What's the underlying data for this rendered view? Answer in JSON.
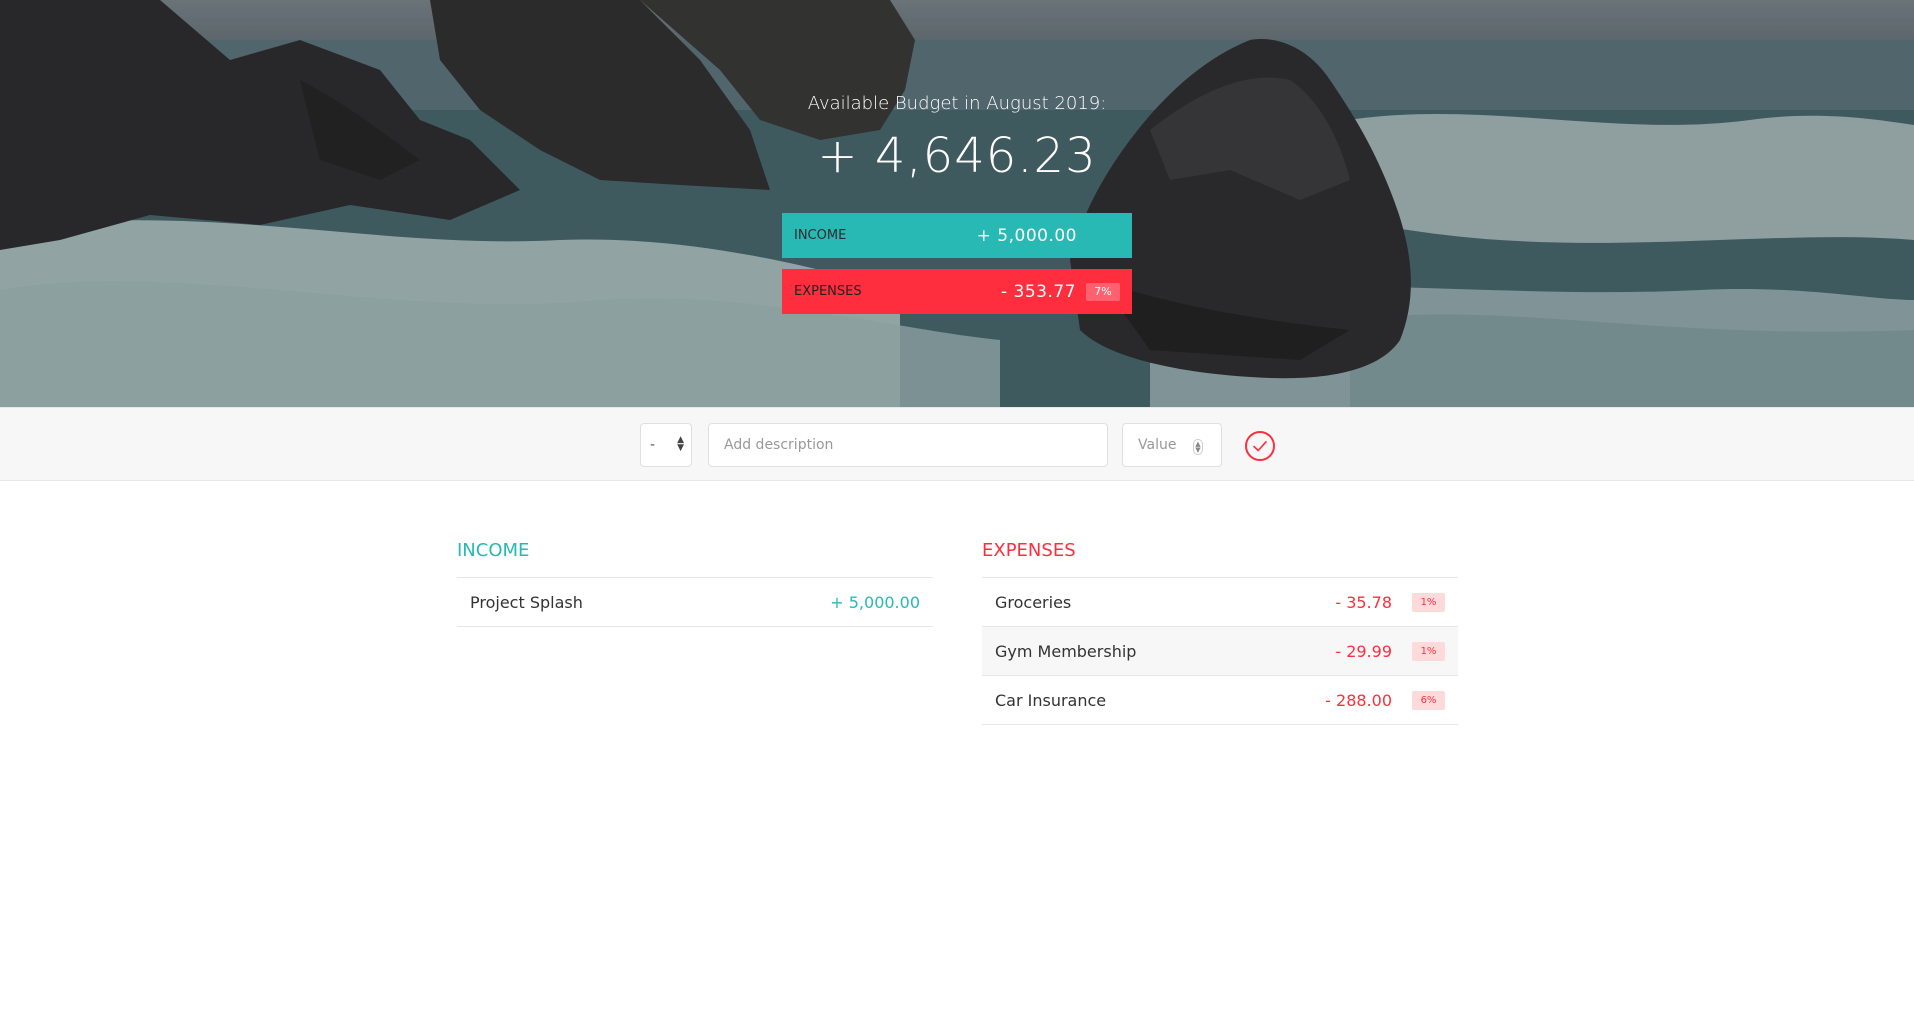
{
  "budget": {
    "title": "Available Budget in August 2019:",
    "value": "+ 4,646.23"
  },
  "summary": {
    "income_label": "Income",
    "income_value": "+ 5,000.00",
    "expenses_label": "Expenses",
    "expenses_value": "- 353.77",
    "expenses_percentage": "7%"
  },
  "add_form": {
    "type_value": "-",
    "description_placeholder": "Add description",
    "value_placeholder": "Value"
  },
  "income_list": {
    "title": "Income",
    "items": [
      {
        "description": "Project Splash",
        "value": "+ 5,000.00"
      }
    ]
  },
  "expenses_list": {
    "title": "Expenses",
    "items": [
      {
        "description": "Groceries",
        "value": "- 35.78",
        "percentage": "1%"
      },
      {
        "description": "Gym Membership",
        "value": "- 29.99",
        "percentage": "1%"
      },
      {
        "description": "Car Insurance",
        "value": "- 288.00",
        "percentage": "6%"
      }
    ]
  },
  "colors": {
    "income": "#28b9b5",
    "expenses": "#ff2e3e"
  }
}
